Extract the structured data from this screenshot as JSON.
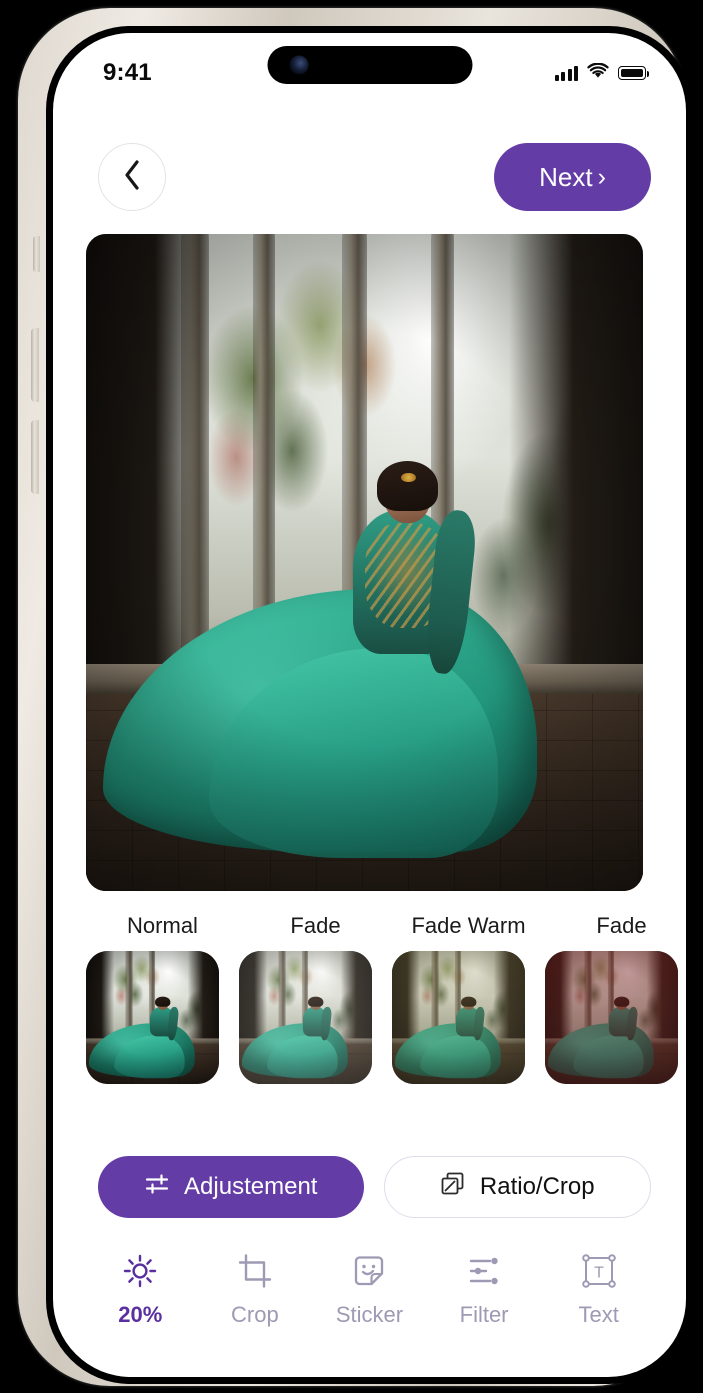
{
  "status_bar": {
    "time": "9:41",
    "cellular_icon": "cellular-signal-icon",
    "wifi_icon": "wifi-icon",
    "battery_icon": "battery-full-icon"
  },
  "header": {
    "back_icon": "chevron-left-icon",
    "next_label": "Next",
    "next_chevron": "›"
  },
  "editor": {
    "photo_alt": "woman-in-teal-lehenga-at-gothic-ruins"
  },
  "filters": {
    "items": [
      {
        "label": "Normal",
        "selected": true
      },
      {
        "label": "Fade",
        "selected": false
      },
      {
        "label": "Fade Warm",
        "selected": false
      },
      {
        "label": "Fade",
        "selected": false
      }
    ]
  },
  "modes": {
    "adjustment_label": "Adjustement",
    "adjustment_icon": "sliders-horizontal-icon",
    "adjustment_active": true,
    "ratio_label": "Ratio/Crop",
    "ratio_icon": "overlapping-squares-icon",
    "ratio_active": false
  },
  "bottom_nav": {
    "items": [
      {
        "label": "20%",
        "icon": "brightness-sun-icon",
        "active": true
      },
      {
        "label": "Crop",
        "icon": "crop-icon",
        "active": false
      },
      {
        "label": "Sticker",
        "icon": "sticker-smiley-icon",
        "active": false
      },
      {
        "label": "Filter",
        "icon": "filter-sliders-icon",
        "active": false
      },
      {
        "label": "Text",
        "icon": "text-box-icon",
        "active": false
      }
    ]
  },
  "colors": {
    "accent_purple": "#643CA6",
    "accent_purple_dark": "#5A2FA0",
    "nav_inactive": "#9f9ab4",
    "dress_teal": "#2ea98c"
  }
}
